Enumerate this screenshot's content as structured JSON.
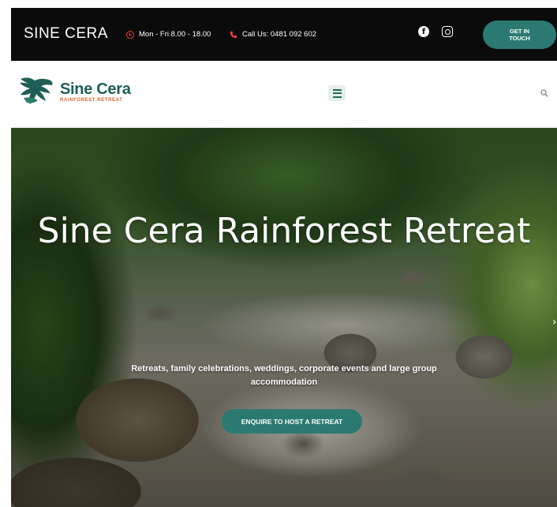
{
  "topbar": {
    "site_name": "SINE CERA",
    "hours": "Mon - Fri 8.00 - 18.00",
    "phone": "Call Us: 0481 092 602",
    "cta": "GET IN TOUCH",
    "icons": {
      "clock": "clock-icon",
      "phone": "phone-icon",
      "facebook": "facebook-icon",
      "instagram": "instagram-icon"
    },
    "accent_color": "#e8452c"
  },
  "nav": {
    "logo_name": "Sine Cera",
    "logo_tagline": "RAINFOREST RETREAT",
    "menu_icon": "hamburger-menu-icon",
    "search_icon": "search-icon"
  },
  "hero": {
    "title": "Sine Cera Rainforest Retreat",
    "subtitle": "Retreats, family celebrations, weddings, corporate events and large group accommodation",
    "cta": "ENQUIRE TO HOST A RETREAT",
    "next_icon": "chevron-right-icon"
  },
  "colors": {
    "brand": "#2a7a72",
    "topbar_bg": "#0b0b0b",
    "logo_text": "#1f5e57",
    "tagline": "#d9602a"
  }
}
